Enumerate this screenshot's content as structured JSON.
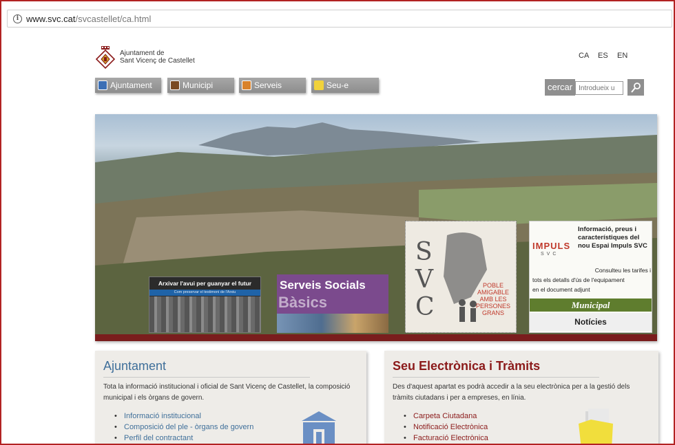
{
  "browser": {
    "url_host": "www.svc.cat",
    "url_path": "/svcastellet/ca.html"
  },
  "header": {
    "logo_line1": "Ajuntament de",
    "logo_line2": "Sant Vicenç de Castellet",
    "languages": [
      "CA",
      "ES",
      "EN"
    ]
  },
  "nav": {
    "items": [
      {
        "label": "Ajuntament",
        "icon": "town-hall-icon",
        "color": "#3c6fb5"
      },
      {
        "label": "Municipi",
        "icon": "building-icon",
        "color": "#7a4a22"
      },
      {
        "label": "Serveis",
        "icon": "services-icon",
        "color": "#d9822b"
      },
      {
        "label": "Seu-e",
        "icon": "folder-icon",
        "color": "#f1d23a"
      }
    ]
  },
  "search": {
    "label": "cercar",
    "placeholder": "Introdueix u"
  },
  "hero": {
    "card1_title": "Arxivar l'avui per guanyar el futur",
    "card1_strip": "Com preservar el testimoni de l'Arxiu",
    "card2_title": "Serveis Socials",
    "card2_sub": "Bàsics",
    "card3_big": "SVC",
    "card3_lines": [
      "POBLE",
      "AMIGABLE",
      "AMB LES",
      "PERSONES",
      "GRANS"
    ],
    "card4_logo": "IMPULS",
    "card4_logo_sub": "SVC",
    "card4_title": "Informació, preus i característiques del nou Espai Impuls SVC",
    "card4_desc1": "Consulteu les tarifes i",
    "card4_desc2": "tots els detalls d'ús de l'equipament",
    "card4_desc3": "en el document adjunt",
    "card4_municipal": "Municipal",
    "card4_noticies": "Notícies"
  },
  "panels": {
    "ajuntament": {
      "title": "Ajuntament",
      "text": "Tota la informació institucional i oficial de Sant Vicenç de Castellet, la composició municipal i els òrgans de govern.",
      "links": [
        "Informació institucional",
        "Composició del ple - òrgans de govern",
        "Perfil del contractant"
      ]
    },
    "seu": {
      "title": "Seu Electrònica i Tràmits",
      "text": "Des d'aquest apartat es podrà accedir a la seu electrònica per a la gestió dels tràmits ciutadans i per a empreses, en línia.",
      "links": [
        "Carpeta Ciutadana",
        "Notificació Electrònica",
        "Facturació Electrònica"
      ]
    }
  },
  "colors": {
    "accent_red": "#8b1a1a",
    "accent_blue": "#3f6f9a",
    "nav_grey": "#9a9a9a"
  }
}
